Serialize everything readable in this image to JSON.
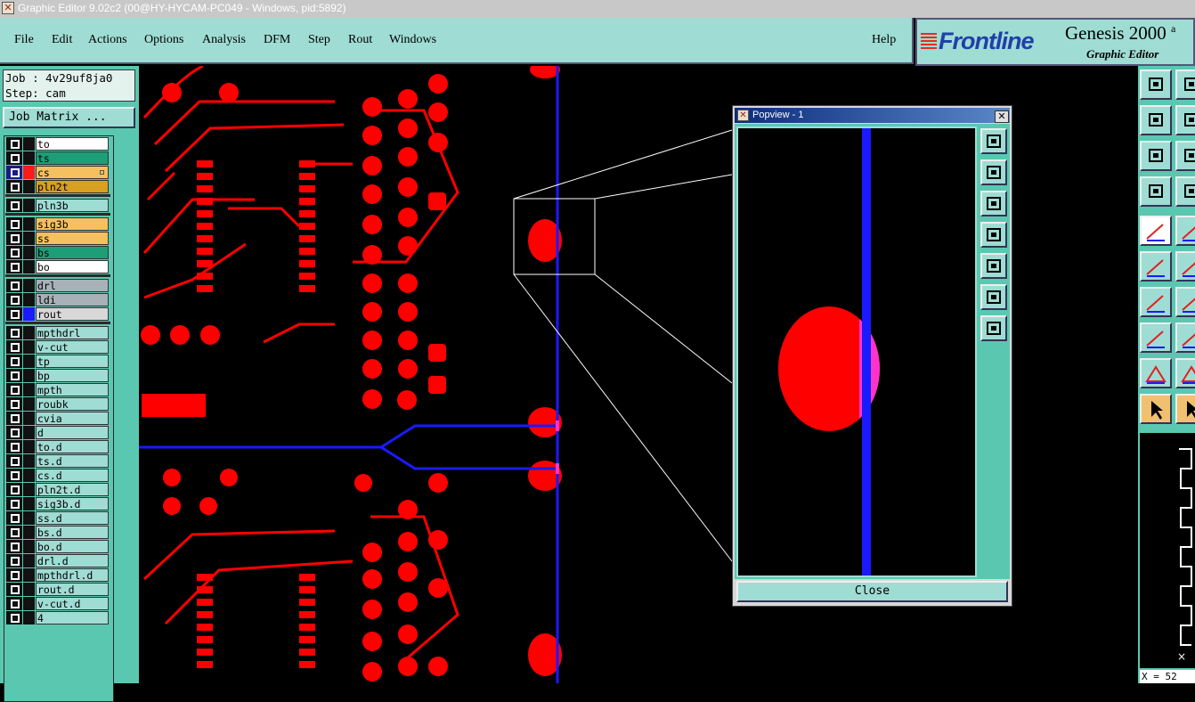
{
  "window": {
    "title": "Graphic Editor 9.02c2 (00@HY-HYCAM-PC049 - Windows, pid:5892)",
    "icon": "app-window-icon"
  },
  "menu": {
    "file": "File",
    "edit": "Edit",
    "actions": "Actions",
    "options": "Options",
    "analysis": "Analysis",
    "dfm": "DFM",
    "step": "Step",
    "rout": "Rout",
    "windows": "Windows",
    "help": "Help"
  },
  "brand": {
    "logo": "Frontline",
    "product": "Genesis 2000",
    "product_suffix": "a",
    "subtitle": "Graphic Editor"
  },
  "job": {
    "job_line": "Job : 4v29uf8ja0",
    "step_line": "Step: cam",
    "matrix_button": "Job Matrix ..."
  },
  "layers": [
    {
      "name": "to",
      "color": "#ffffff"
    },
    {
      "name": "ts",
      "color": "#1e9e76"
    },
    {
      "name": "cs",
      "color": "#f5c060",
      "active": true,
      "swatch": "#ff1a1a"
    },
    {
      "name": "pln2t",
      "color": "#d8a020"
    },
    {
      "name": "pln3b",
      "color": "#9fdcd4"
    },
    {
      "name": "sig3b",
      "color": "#f5c060"
    },
    {
      "name": "ss",
      "color": "#f5c060"
    },
    {
      "name": "bs",
      "color": "#1e9e76"
    },
    {
      "name": "bo",
      "color": "#ffffff"
    },
    {
      "name": "drl",
      "color": "#a8b0b8"
    },
    {
      "name": "ldi",
      "color": "#a8b0b8"
    },
    {
      "name": "rout",
      "color": "#d8d8d8",
      "swatch": "#1a1aff"
    },
    {
      "name": "mpthdrl",
      "color": "#9fdcd4"
    },
    {
      "name": "v-cut",
      "color": "#9fdcd4"
    },
    {
      "name": "tp",
      "color": "#9fdcd4"
    },
    {
      "name": "bp",
      "color": "#9fdcd4"
    },
    {
      "name": "mpth",
      "color": "#9fdcd4"
    },
    {
      "name": "roubk",
      "color": "#9fdcd4"
    },
    {
      "name": "cvia",
      "color": "#9fdcd4"
    },
    {
      "name": "d",
      "color": "#9fdcd4"
    },
    {
      "name": "to.d",
      "color": "#9fdcd4"
    },
    {
      "name": "ts.d",
      "color": "#9fdcd4"
    },
    {
      "name": "cs.d",
      "color": "#9fdcd4"
    },
    {
      "name": "pln2t.d",
      "color": "#9fdcd4"
    },
    {
      "name": "sig3b.d",
      "color": "#9fdcd4"
    },
    {
      "name": "ss.d",
      "color": "#9fdcd4"
    },
    {
      "name": "bs.d",
      "color": "#9fdcd4"
    },
    {
      "name": "bo.d",
      "color": "#9fdcd4"
    },
    {
      "name": "drl.d",
      "color": "#9fdcd4"
    },
    {
      "name": "mpthdrl.d",
      "color": "#9fdcd4"
    },
    {
      "name": "rout.d",
      "color": "#9fdcd4"
    },
    {
      "name": "v-cut.d",
      "color": "#9fdcd4"
    },
    {
      "name": "4",
      "color": "#9fdcd4"
    }
  ],
  "popview": {
    "title": "Popview - 1",
    "close_button": "Close",
    "close_icon": "close-icon",
    "tools": [
      "zoom-box-icon",
      "pan-up-icon",
      "pan-down-icon",
      "pan-left-icon",
      "pan-right-icon",
      "zoom-out-icon",
      "zoom-in-icon"
    ]
  },
  "right_tools": [
    "pan-up-icon",
    "pan-down-icon",
    "pan-left-icon",
    "pan-right-icon",
    "zoom-fit-icon",
    "zoom-home-icon",
    "tool-settings-icon",
    "grid-icon",
    "snap-icon",
    "measure-icon",
    "net-icon",
    "cross-icon",
    "line-icon",
    "red-line-icon",
    "points-icon",
    "horizontal-line-icon",
    "triangle-icon",
    "triangle-alt-icon",
    "select-arrow-icon",
    "select-box-icon"
  ],
  "status": {
    "coordinate": "X = 52"
  },
  "colors": {
    "panel": "#5ac8b0",
    "menubar": "#9fdcd4",
    "copper": "#ff0000",
    "rout": "#1a1aff",
    "highlight": "#ff33cc"
  }
}
